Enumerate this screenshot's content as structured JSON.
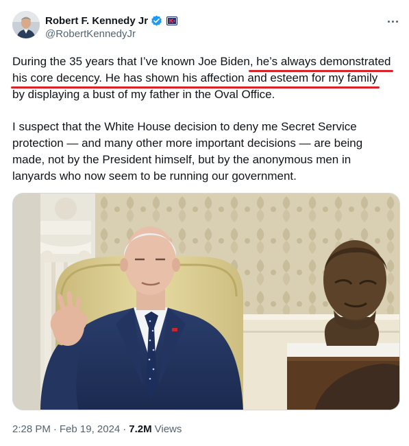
{
  "author": {
    "display_name": "Robert F. Kennedy Jr",
    "handle": "@RobertKennedyJr",
    "avatar_icon": "person-avatar",
    "verified_icon": "verified-badge-icon",
    "affiliation_icon": "campaign-flag-icon",
    "verified_color": "#1d9bf0"
  },
  "more_icon": "more-horizontal-icon",
  "tweet": {
    "p1_l1_a": "During the 35 years that I’ve known Joe Biden",
    "p1_l1_b": ", he’s always demonstrated",
    "p1_l2_a": "his core decency. He has shown his affection and esteem for my family",
    "p1_l3": "by displaying a bust of my father in the Oval Office.",
    "p2_l1": "I suspect that the White House decision to deny me Secret Service",
    "p2_l2": "protection — and many other more important decisions — are being",
    "p2_l3": "made, not by the President himself, but by the anonymous men in",
    "p2_l4": "lanyards who now seem to be running our government."
  },
  "highlight_color": "#d9222a",
  "media": {
    "description_icon": "photo-president-oval-office-bust"
  },
  "meta": {
    "time": "2:28 PM",
    "sep1": "·",
    "date": "Feb 19, 2024",
    "sep2": "·",
    "views_count": "7.2M",
    "views_label": "Views"
  },
  "colors": {
    "text": "#0f1419",
    "secondary": "#536471"
  }
}
